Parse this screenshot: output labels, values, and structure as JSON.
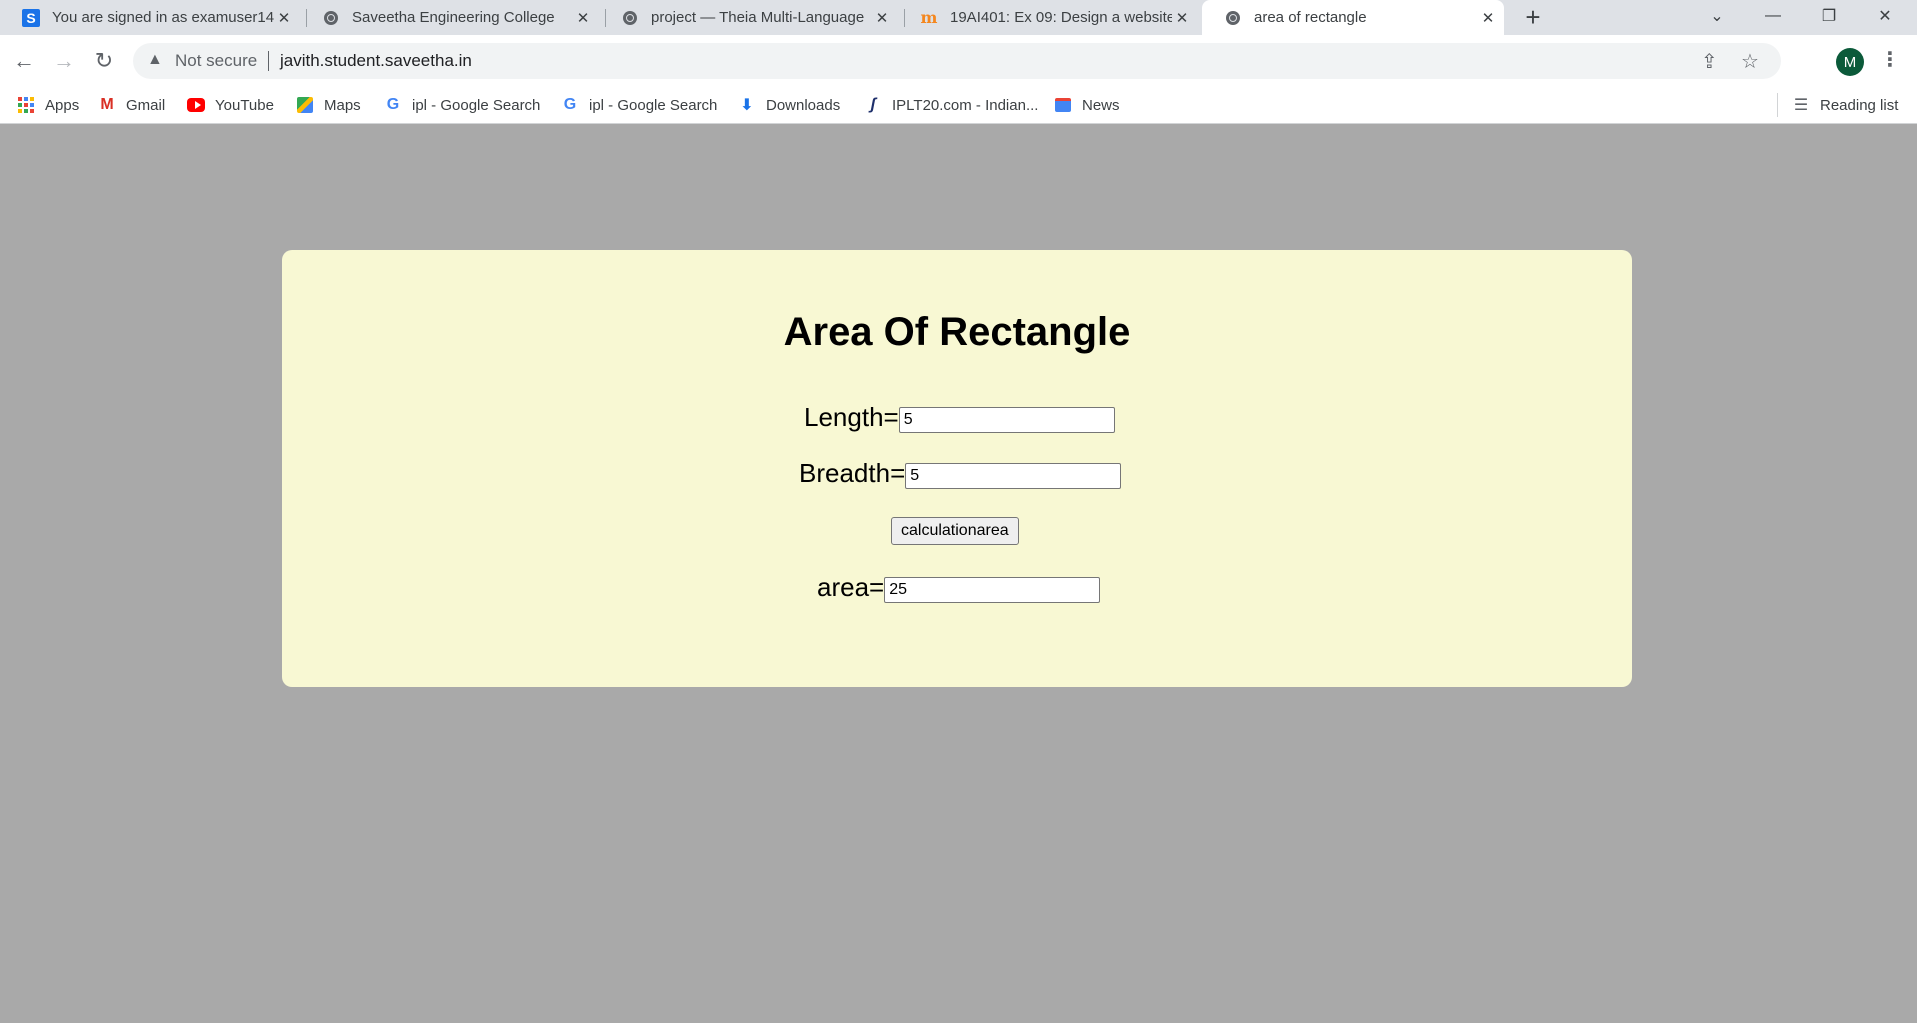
{
  "browser": {
    "tabs": [
      {
        "title": "You are signed in as examuser14",
        "favicon": "s-icon",
        "active": false
      },
      {
        "title": "Saveetha Engineering College",
        "favicon": "globe-icon",
        "active": false
      },
      {
        "title": "project — Theia Multi-Language",
        "favicon": "globe-icon",
        "active": false
      },
      {
        "title": "19AI401: Ex 09: Design a website",
        "favicon": "moodle-icon",
        "active": false
      },
      {
        "title": "area of rectangle",
        "favicon": "globe-icon",
        "active": true
      }
    ],
    "security_label": "Not secure",
    "url": "javith.student.saveetha.in",
    "profile_initial": "M",
    "bookmarks": [
      {
        "label": "Apps",
        "icon": "apps-icon"
      },
      {
        "label": "Gmail",
        "icon": "gmail-icon"
      },
      {
        "label": "YouTube",
        "icon": "youtube-icon"
      },
      {
        "label": "Maps",
        "icon": "maps-icon"
      },
      {
        "label": "ipl - Google Search",
        "icon": "google-icon"
      },
      {
        "label": "ipl - Google Search",
        "icon": "google-icon"
      },
      {
        "label": "Downloads",
        "icon": "download-icon"
      },
      {
        "label": "IPLT20.com - Indian...",
        "icon": "iplt20-icon"
      },
      {
        "label": "News",
        "icon": "news-icon"
      }
    ],
    "reading_list_label": "Reading list"
  },
  "page": {
    "title": "Area Of Rectangle",
    "length_label": "Length=",
    "length_value": "5",
    "breadth_label": "Breadth=",
    "breadth_value": "5",
    "button_label": "calculationarea",
    "area_label": "area=",
    "area_value": "25"
  },
  "colors": {
    "page_background": "#a9a9a9",
    "card_background": "#f8f8d3",
    "tabstrip": "#dee1e6"
  }
}
